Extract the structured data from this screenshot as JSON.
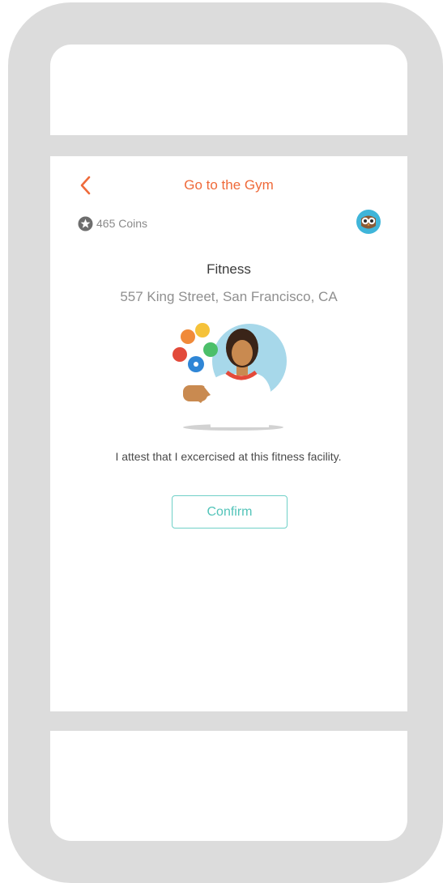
{
  "nav": {
    "title": "Go to the Gym"
  },
  "wallet": {
    "coins_label": "465 Coins"
  },
  "facility": {
    "name": "Fitness",
    "address": "557 King Street, San Francisco, CA"
  },
  "attestation": {
    "text": "I attest that I excercised at this fitness facility.",
    "confirm_label": "Confirm"
  },
  "icons": {
    "back": "chevron-left-icon",
    "coin": "coin-star-icon",
    "avatar": "owl-avatar-icon",
    "illustration": "fitness-person-illustration"
  },
  "colors": {
    "accent": "#ef6a3a",
    "confirm": "#53c4b9",
    "frame": "#dcdcdc"
  }
}
